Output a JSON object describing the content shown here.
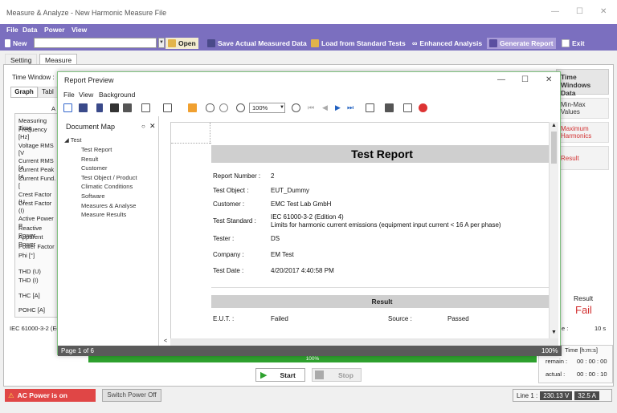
{
  "window": {
    "title": "Measure & Analyze - New Harmonic Measure File"
  },
  "menu": [
    "File",
    "Data",
    "Power",
    "View"
  ],
  "toolbar": {
    "new": "New",
    "open": "Open",
    "save_actual": "Save Actual Measured Data",
    "load_std": "Load from Standard Tests",
    "enhanced": "Enhanced Analysis",
    "generate": "Generate Report",
    "exit": "Exit"
  },
  "tabs": [
    "Setting",
    "Measure"
  ],
  "measure": {
    "time_window_label": "Time Window :",
    "subtabs": [
      "Graph",
      "Tabl"
    ],
    "col_header": "A",
    "rows": [
      "Measuring Time",
      "Frequency [Hz]",
      "Voltage RMS [V",
      "Current RMS [A",
      "Current Peak [A",
      "Current Fund. [",
      "Crest Factor (U",
      "Crest Factor (I)",
      "Active Power P",
      "Reactive Power",
      "Apparent Power",
      "Power Factor",
      "Phi [°]",
      "THD (U)",
      "THD (I)",
      "THC [A]",
      "POHC [A]"
    ],
    "standard": "IEC 61000-3-2 (Edi"
  },
  "right_panel": {
    "time_windows": "Time Windows Data",
    "minmax": "Min-Max Values",
    "maxharm": "Maximum Harmonics",
    "result": "Result",
    "result_title": "Result",
    "result_value": "Fail",
    "interval_label": "e :",
    "interval_value": "10 s",
    "time_title": "Time [h:m:s]",
    "remain_label": "remain :",
    "remain_value": "00 : 00 : 00",
    "actual_label": "actual :",
    "actual_value": "00 : 00 : 10"
  },
  "progress": {
    "percent": 100,
    "label": "100%"
  },
  "controls": {
    "start": "Start",
    "stop": "Stop"
  },
  "status": {
    "ac_power": "AC Power is on",
    "switch_power": "Switch Power Off",
    "line_label": "Line 1 :",
    "voltage": "230.13 V",
    "current": "32.5 A"
  },
  "dialog": {
    "title": "Report Preview",
    "menu": [
      "File",
      "View",
      "Background"
    ],
    "zoom": "100%",
    "docmap_title": "Document Map",
    "tree_root": "Test",
    "tree_items": [
      "Test Report",
      "Result",
      "Customer",
      "Test Object / Product",
      "Climatic Conditions",
      "Software",
      "Measures & Analyse",
      "Measure Results"
    ],
    "page_label": "Page 1 of 6",
    "zoom_status": "100%"
  },
  "report": {
    "heading": "Test Report",
    "fields": [
      {
        "label": "Report Number :",
        "value": "2"
      },
      {
        "label": "Test Object :",
        "value": "EUT_Dummy"
      },
      {
        "label": "Customer :",
        "value": "EMC Test Lab GmbH"
      },
      {
        "label": "Test Standard :",
        "value": "IEC 61000-3-2 (Edition 4)",
        "value2": "Limits for harmonic current emissions (equipment input current < 16 A per phase)"
      },
      {
        "label": "Tester :",
        "value": "DS"
      },
      {
        "label": "Company :",
        "value": "EM Test"
      },
      {
        "label": "Test Date :",
        "value": "4/20/2017 4:40:58 PM"
      }
    ],
    "result_heading": "Result",
    "eut_label": "E.U.T. :",
    "eut_value": "Failed",
    "source_label": "Source :",
    "source_value": "Passed"
  }
}
